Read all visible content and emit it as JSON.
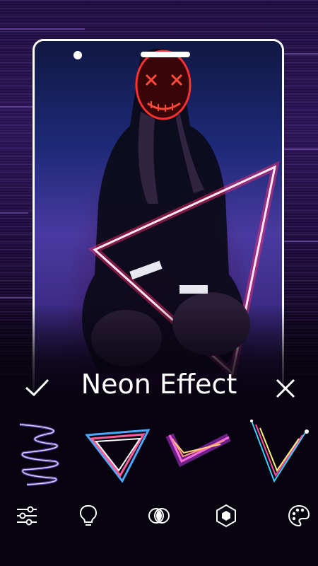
{
  "screen_title": "Neon Effect",
  "actions": {
    "confirm_icon": "check-icon",
    "close_icon": "close-icon"
  },
  "effects": [
    {
      "name": "spiral-neon-effect"
    },
    {
      "name": "triangle-neon-effect"
    },
    {
      "name": "checkmark-neon-effect"
    },
    {
      "name": "v-shape-neon-effect"
    }
  ],
  "toolbar": [
    {
      "icon": "sliders-icon"
    },
    {
      "icon": "lightbulb-icon"
    },
    {
      "icon": "overlap-circles-icon"
    },
    {
      "icon": "hexagon-badge-icon"
    },
    {
      "icon": "palette-icon"
    }
  ],
  "colors": {
    "accent_pink": "#ff2d6f",
    "accent_purple": "#8a4dff",
    "background": "#07030f"
  }
}
